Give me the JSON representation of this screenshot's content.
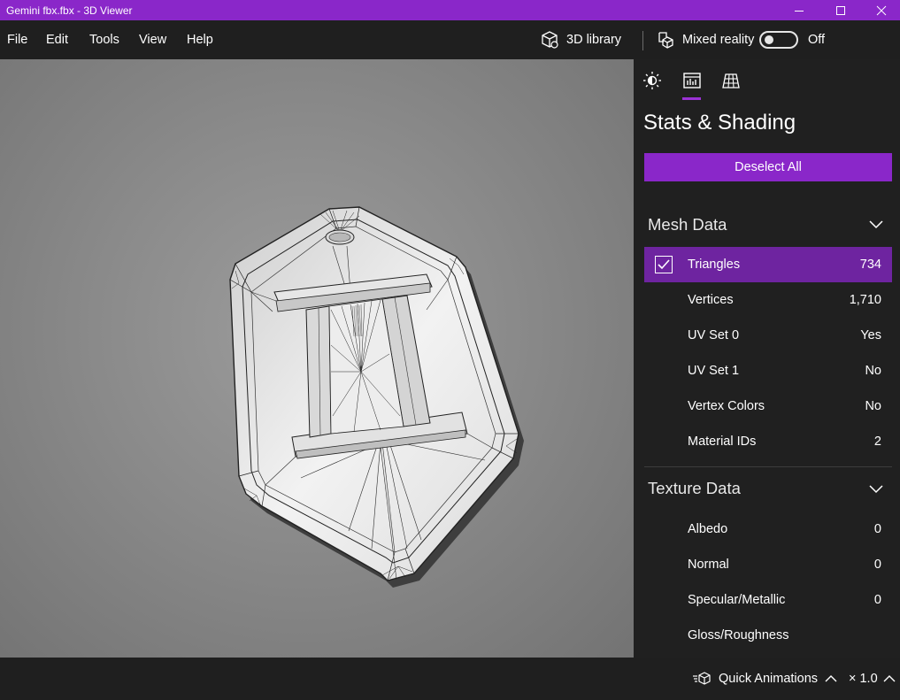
{
  "window": {
    "title": "Gemini fbx.fbx - 3D Viewer"
  },
  "menu": {
    "file": "File",
    "edit": "Edit",
    "tools": "Tools",
    "view": "View",
    "help": "Help"
  },
  "toolbar": {
    "library_label": "3D library",
    "mixed_reality_label": "Mixed reality",
    "mixed_reality_state": "Off",
    "mixed_reality_on": false
  },
  "panel": {
    "tabs": [
      {
        "icon": "lighting-icon",
        "active": false
      },
      {
        "icon": "stats-icon",
        "active": true
      },
      {
        "icon": "grid-icon",
        "active": false
      }
    ],
    "title": "Stats & Shading",
    "deselect_label": "Deselect All",
    "mesh": {
      "header": "Mesh Data",
      "rows": [
        {
          "label": "Triangles",
          "value": "734",
          "checked": true
        },
        {
          "label": "Vertices",
          "value": "1,710"
        },
        {
          "label": "UV Set 0",
          "value": "Yes"
        },
        {
          "label": "UV Set 1",
          "value": "No"
        },
        {
          "label": "Vertex Colors",
          "value": "No"
        },
        {
          "label": "Material IDs",
          "value": "2"
        }
      ]
    },
    "texture": {
      "header": "Texture Data",
      "rows": [
        {
          "label": "Albedo",
          "value": "0"
        },
        {
          "label": "Normal",
          "value": "0"
        },
        {
          "label": "Specular/Metallic",
          "value": "0"
        },
        {
          "label": "Gloss/Roughness",
          "value": ""
        }
      ]
    }
  },
  "bottom": {
    "quick_animations": "Quick Animations",
    "speed": "× 1.0"
  },
  "colors": {
    "accent": "#8a27c9",
    "selected_row": "#6e24a0",
    "background": "#1f1f1f"
  }
}
